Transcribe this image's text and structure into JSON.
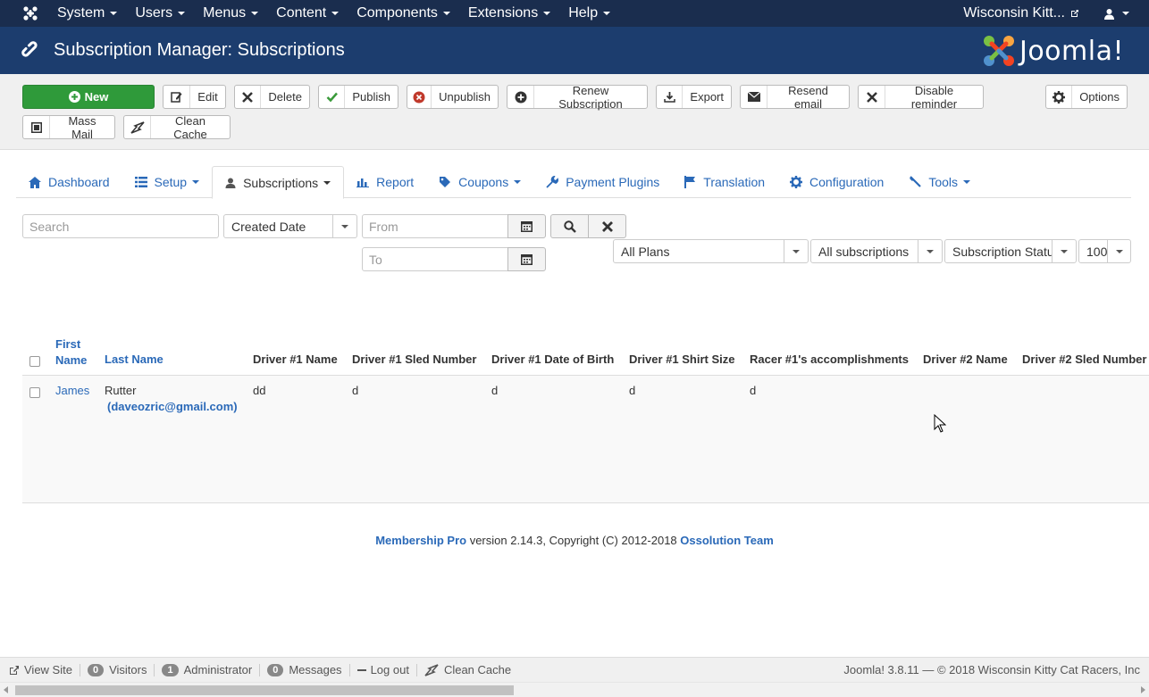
{
  "topnav": {
    "menu": [
      "System",
      "Users",
      "Menus",
      "Content",
      "Components",
      "Extensions",
      "Help"
    ],
    "site_name": "Wisconsin Kitt..."
  },
  "header": {
    "title": "Subscription Manager: Subscriptions",
    "brand": "Joomla!"
  },
  "toolbar": {
    "new": "New",
    "edit": "Edit",
    "delete": "Delete",
    "publish": "Publish",
    "unpublish": "Unpublish",
    "renew": "Renew Subscription",
    "export": "Export",
    "resend": "Resend email",
    "disable_reminder": "Disable reminder",
    "options": "Options",
    "mass_mail": "Mass Mail",
    "clean_cache": "Clean Cache"
  },
  "tabs": {
    "dashboard": "Dashboard",
    "setup": "Setup",
    "subscriptions": "Subscriptions",
    "report": "Report",
    "coupons": "Coupons",
    "payment_plugins": "Payment Plugins",
    "translation": "Translation",
    "configuration": "Configuration",
    "tools": "Tools"
  },
  "filters": {
    "search_placeholder": "Search",
    "date_type": "Created Date",
    "from_placeholder": "From",
    "to_placeholder": "To",
    "plans": "All Plans",
    "subscriptions": "All subscriptions",
    "status": "Subscription Status",
    "limit": "100"
  },
  "table": {
    "headers": {
      "first_name_1": "First",
      "first_name_2": "Name",
      "last_name": "Last Name",
      "d1_name": "Driver #1 Name",
      "d1_sled": "Driver #1 Sled Number",
      "d1_dob": "Driver #1 Date of Birth",
      "d1_shirt": "Driver #1 Shirt Size",
      "r1_acc": "Racer #1's accomplishments",
      "d2_name": "Driver #2 Name",
      "d2_sled": "Driver #2 Sled Number"
    },
    "row": {
      "first_name": "James",
      "last_name": "Rutter",
      "email": "(daveozric@gmail.com)",
      "d1_name": "dd",
      "d1_sled": "d",
      "d1_dob": "d",
      "d1_shirt": "d",
      "r1_acc": "d"
    }
  },
  "footer": {
    "product": "Membership Pro",
    "text": " version 2.14.3, Copyright (C) 2012-2018 ",
    "team": "Ossolution Team"
  },
  "statusbar": {
    "view_site": "View Site",
    "visitors_count": "0",
    "visitors": "Visitors",
    "admin_count": "1",
    "admin": "Administrator",
    "messages_count": "0",
    "messages": "Messages",
    "logout": "Log out",
    "clean_cache": "Clean Cache",
    "right": "Joomla! 3.8.11  —  © 2018 Wisconsin Kitty Cat Racers, Inc"
  }
}
